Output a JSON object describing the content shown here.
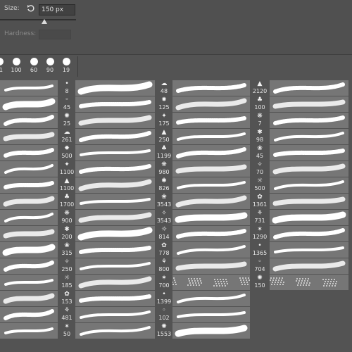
{
  "settings": {
    "size_label": "Size:",
    "size_value": "150 px",
    "hardness_label": "Hardness:",
    "hardness_value": ""
  },
  "recent_brushes": [
    "11",
    "100",
    "60",
    "90",
    "19"
  ],
  "presets": {
    "col1": [
      "8",
      "45",
      "25",
      "261",
      "500",
      "1100",
      "1100",
      "1700",
      "900",
      "200",
      "315",
      "250",
      "185",
      "153",
      "481",
      "50"
    ],
    "col2": [
      "48",
      "125",
      "175",
      "250",
      "1199",
      "980",
      "826",
      "3543",
      "3543",
      "814",
      "778",
      "800",
      "700",
      "1399",
      "102",
      "1553"
    ],
    "col3": [
      "2120",
      "100",
      "7",
      "98",
      "45",
      "70",
      "500",
      "1361",
      "731",
      "1290",
      "1365",
      "704",
      "150"
    ]
  },
  "colors": {
    "panel_bg": "#535353",
    "preview_bg": "#767676",
    "stroke": "#ffffff"
  }
}
